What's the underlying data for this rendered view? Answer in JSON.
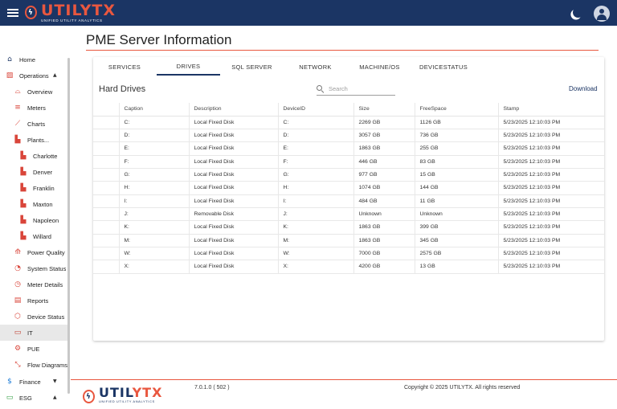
{
  "header": {
    "brand_part1": "UTIL",
    "brand_part2": "YTX",
    "tagline": "UNIFIED UTILITY ANALYTICS",
    "accent_color": "#e9573f",
    "bar_color": "#1b3564",
    "icons": [
      "menu-icon",
      "moon-icon",
      "user-avatar-icon"
    ]
  },
  "sidebar": {
    "items": [
      {
        "label": "Home",
        "icon": "home-icon"
      },
      {
        "label": "Operations",
        "icon": "operations-icon",
        "caret": "▲"
      },
      {
        "label": "Overview",
        "icon": "overview-icon"
      },
      {
        "label": "Meters",
        "icon": "meters-icon"
      },
      {
        "label": "Charts",
        "icon": "charts-icon"
      },
      {
        "label": "Plants...",
        "icon": "plant-icon"
      },
      {
        "label": "Charlotte",
        "icon": "plant-icon"
      },
      {
        "label": "Denver",
        "icon": "plant-icon"
      },
      {
        "label": "Franklin",
        "icon": "plant-icon"
      },
      {
        "label": "Maxton",
        "icon": "plant-icon"
      },
      {
        "label": "Napoleon",
        "icon": "plant-icon"
      },
      {
        "label": "Willard",
        "icon": "plant-icon"
      },
      {
        "label": "Power Quality",
        "icon": "power-quality-icon"
      },
      {
        "label": "System Status",
        "icon": "system-status-icon"
      },
      {
        "label": "Meter Details",
        "icon": "meter-details-icon"
      },
      {
        "label": "Reports",
        "icon": "reports-icon"
      },
      {
        "label": "Device Status",
        "icon": "device-status-icon"
      },
      {
        "label": "IT",
        "icon": "laptop-icon"
      },
      {
        "label": "PUE",
        "icon": "pue-icon"
      },
      {
        "label": "Flow Diagrams",
        "icon": "flow-diagram-icon"
      },
      {
        "label": "Finance",
        "icon": "finance-icon",
        "caret": "▼"
      },
      {
        "label": "ESG",
        "icon": "esg-icon",
        "caret": "▲"
      }
    ]
  },
  "main": {
    "title": "PME Server Information",
    "tabs": [
      {
        "label": "SERVICES"
      },
      {
        "label": "DRIVES"
      },
      {
        "label": "SQL SERVER"
      },
      {
        "label": "NETWORK"
      },
      {
        "label": "MACHINE/OS"
      },
      {
        "label": "DEVICESTATUS"
      }
    ],
    "active_tab": "DRIVES",
    "section_title": "Hard Drives",
    "search_placeholder": "Search",
    "download_label": "Download",
    "columns": [
      "Caption",
      "Description",
      "DeviceID",
      "Size",
      "FreeSpace",
      "Stamp"
    ],
    "rows": [
      [
        "C:",
        "Local Fixed Disk",
        "C:",
        "2269 GB",
        "1126 GB",
        "5/23/2025 12:10:03 PM"
      ],
      [
        "D:",
        "Local Fixed Disk",
        "D:",
        "3057 GB",
        "736 GB",
        "5/23/2025 12:10:03 PM"
      ],
      [
        "E:",
        "Local Fixed Disk",
        "E:",
        "1863 GB",
        "255 GB",
        "5/23/2025 12:10:03 PM"
      ],
      [
        "F:",
        "Local Fixed Disk",
        "F:",
        "446 GB",
        "83 GB",
        "5/23/2025 12:10:03 PM"
      ],
      [
        "G:",
        "Local Fixed Disk",
        "G:",
        "977 GB",
        "15 GB",
        "5/23/2025 12:10:03 PM"
      ],
      [
        "H:",
        "Local Fixed Disk",
        "H:",
        "1074 GB",
        "144 GB",
        "5/23/2025 12:10:03 PM"
      ],
      [
        "I:",
        "Local Fixed Disk",
        "I:",
        "484 GB",
        "11 GB",
        "5/23/2025 12:10:03 PM"
      ],
      [
        "J:",
        "Removable Disk",
        "J:",
        "Unknown",
        "Unknown",
        "5/23/2025 12:10:03 PM"
      ],
      [
        "K:",
        "Local Fixed Disk",
        "K:",
        "1863 GB",
        "399 GB",
        "5/23/2025 12:10:03 PM"
      ],
      [
        "M:",
        "Local Fixed Disk",
        "M:",
        "1863 GB",
        "345 GB",
        "5/23/2025 12:10:03 PM"
      ],
      [
        "W:",
        "Local Fixed Disk",
        "W:",
        "7000 GB",
        "2575 GB",
        "5/23/2025 12:10:03 PM"
      ],
      [
        "X:",
        "Local Fixed Disk",
        "X:",
        "4200 GB",
        "13 GB",
        "5/23/2025 12:10:03 PM"
      ]
    ]
  },
  "footer": {
    "version": "7.0.1.0 ( 502 )",
    "copyright": "Copyright © 2025 UTILYTX. All rights reserved"
  }
}
